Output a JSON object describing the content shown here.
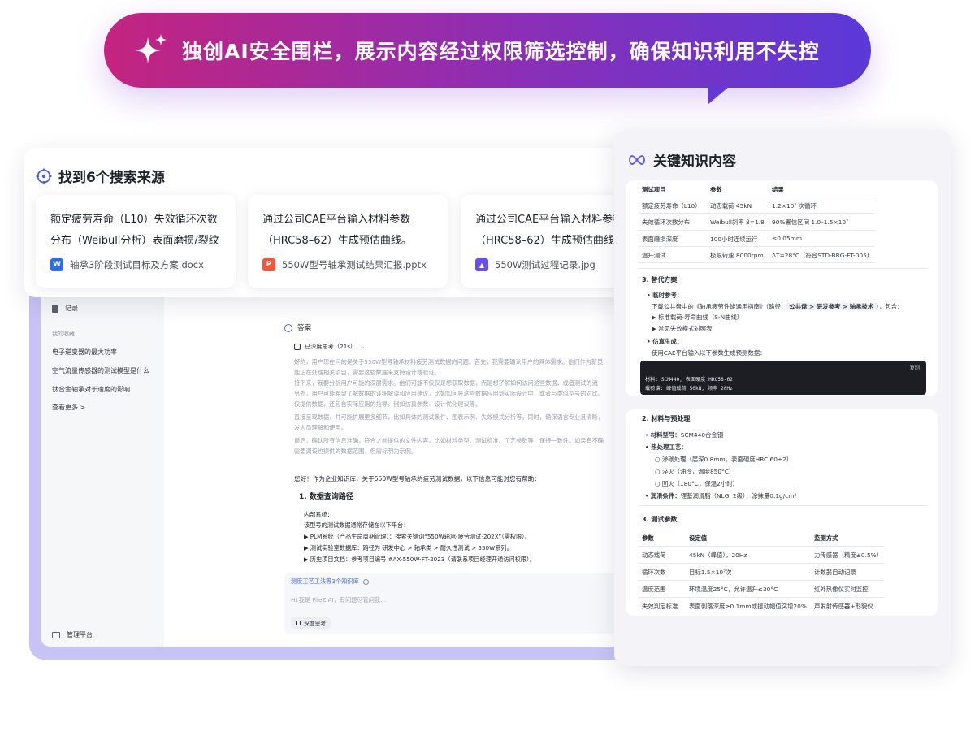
{
  "banner": {
    "text": "独创AI安全围栏，展示内容经过权限筛选控制，确保知识利用不失控"
  },
  "sources": {
    "title": "找到6个搜索来源",
    "cards": [
      {
        "title": "额定疲劳寿命（L10）失效循环次数分布（Weibull分析）表面磨损/裂纹",
        "file": "轴承3阶段测试目标及方案.docx",
        "badge": "W",
        "color": "#2b6cf2"
      },
      {
        "title": "通过公司CAE平台输入材料参数（HRC58–62）生成预估曲线。",
        "file": "550W型号轴承测试结果汇报.pptx",
        "badge": "P",
        "color": "#f2553d"
      },
      {
        "title": "通过公司CAE平台输入材料参数（HRC58–62）生成预估曲线。",
        "file": "550W测试过程记录.jpg",
        "badge": "▲",
        "color": "#6a4cf0"
      }
    ]
  },
  "app": {
    "sidebar": {
      "record": "记录",
      "favorites": "我的收藏",
      "items": [
        "电子逆变器的最大功率",
        "空气流量传感器的测试模型是什么",
        "钛合金轴承对于速度的影响"
      ],
      "more": "查看更多 >",
      "admin": "管理平台"
    },
    "main": {
      "answer": "答案",
      "thinking": "已深度思考（21s）",
      "para": [
        "好的，用户现在问的是关于550W型号轴承材料疲劳测试数据的问题。首先，我需要确认用户的具体需求。他们作为新员",
        "能正在处理相关项目，需要这些数据来支持设计或验证。",
        "接下来，我要分析用户可能的深层需求。他们可能不仅仅是想获取数据，而是想了解如何访问这些数据，或者测试的流",
        "另外，用户可能希望了解数据的详细解读和应用建议，比如如何将这些数据应用到实际设计中，或者与类似型号的对比。",
        "仅提供数据，还包含实际应用的指导，例如仿真参数、设计优化建议等。",
        "直接呈现数据，并可能扩展更多细节，比如具体的测试条件、图表示例、失效模式分析等。同时，确保语言专业且清晰，",
        "发人员理解和使用。",
        "最后，确认所有信息准确，符合之前提供的文件内容，比如材料类型、测试标准、工艺参数等，保持一致性。如果有不确",
        "需要调设也提供的数据范围，但需标明为示例。"
      ],
      "intro": "您好！作为企业知识库，关于550W型号轴承的疲劳测试数据，以下信息可能对您有帮助：",
      "section1": "1. 数据查询路径",
      "internal": "内部系统：",
      "platforms": "该型号的测试数据通常存储在以下平台：",
      "bullets": [
        "▶ PLM系统（产品生命周期管理）：搜索关键词“550W轴承-疲劳测试-202X”（需权限）。",
        "▶ 测试实验室数据库：路径为 研发中心 > 轴承类 > 耐久性测试 > 550W系列。",
        "▶ 历史项目文档：参考项目编号 #AX-550W-FT-2023（请联系项目经理开通访问权限）。"
      ],
      "ref": "测度工艺工法等3个知识库",
      "placeholder": "Hi 我是 FileZ AI，有问题尽管问我...",
      "deep": "深度思考"
    }
  },
  "knowledge": {
    "title": "关键知识内容",
    "table1": {
      "headers": [
        "测试项目",
        "参数",
        "结果"
      ],
      "rows": [
        [
          "额定疲劳寿命（L10）",
          "动态载荷 45kN",
          "1.2×10⁷ 次循环"
        ],
        [
          "失效循环次数分布",
          "Weibull斜率 β=1.8",
          "90%置信区间 1.0–1.5×10⁷"
        ],
        [
          "表面磨损深度",
          "100小时连续运行",
          "≤0.05mm"
        ],
        [
          "温升测试",
          "极限转速 8000rpm",
          "ΔT=28°C（符合STD-BRG-FT-005)"
        ]
      ]
    },
    "sec3": "3. 替代方案",
    "ref_title": "临时参考：",
    "ref_text": "下载公共盘中的《轴承疲劳性能通用指南》（路径：",
    "ref_path": "公共盘 > 研发参考 > 轴承技术",
    "ref_tail": "），包含：",
    "ref_items": [
      "▶ 标准载荷-寿命曲线（S-N曲线）",
      "▶ 常见失效模式对照表"
    ],
    "sim_title": "仿真生成：",
    "sim_text": "使用CAE平台输入以下参数生成预测数据：",
    "copy": "复制",
    "code": [
      "材料: SCM440, 表面硬度 HRC58-62",
      "载荷谱: 峰值载荷 50kN, 频率 20Hz"
    ],
    "sec2": "2. 材料与预处理",
    "material_label": "材料型号：",
    "material": "SCM440合金钢",
    "heat_label": "热处理工艺：",
    "heat_items": [
      "渗碳处理（层深0.8mm，表面硬度HRC 60±2）",
      "淬火（油冷，温度850°C）",
      "回火（180°C，保温2小时）"
    ],
    "lube_label": "润滑条件：",
    "lube": "锂基润滑脂（NLGI 2级），涂抹量0.1g/cm²",
    "sec3b": "3. 测试参数",
    "table2": {
      "headers": [
        "参数",
        "设定值",
        "监测方式"
      ],
      "rows": [
        [
          "动态载荷",
          "45kN（峰值），20Hz",
          "力传感器（精度±0.5%）"
        ],
        [
          "循环次数",
          "目标1.5×10⁷次",
          "计数器自动记录"
        ],
        [
          "温度范围",
          "环境温度25°C，允许温升≤30°C",
          "红外热像仪实时监控"
        ],
        [
          "失效判定标准",
          "表面剥落深度≥0.1mm或振动幅值突增20%",
          "声发射传感器+形貌仪"
        ]
      ]
    }
  }
}
